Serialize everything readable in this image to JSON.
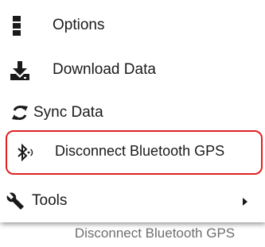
{
  "menu": {
    "items": [
      {
        "label": "Options",
        "icon": "options-icon"
      },
      {
        "label": "Download Data",
        "icon": "download-icon"
      },
      {
        "label": "Sync Data",
        "icon": "sync-icon"
      },
      {
        "label": "Disconnect Bluetooth GPS",
        "icon": "bluetooth-icon",
        "highlighted": true
      },
      {
        "label": "Tools",
        "icon": "wrench-icon",
        "has_submenu": true
      }
    ]
  },
  "caption": "Disconnect Bluetooth GPS",
  "colors": {
    "highlight_border": "#e02020",
    "text": "#1a1a1a",
    "caption": "#6e6e6e"
  }
}
